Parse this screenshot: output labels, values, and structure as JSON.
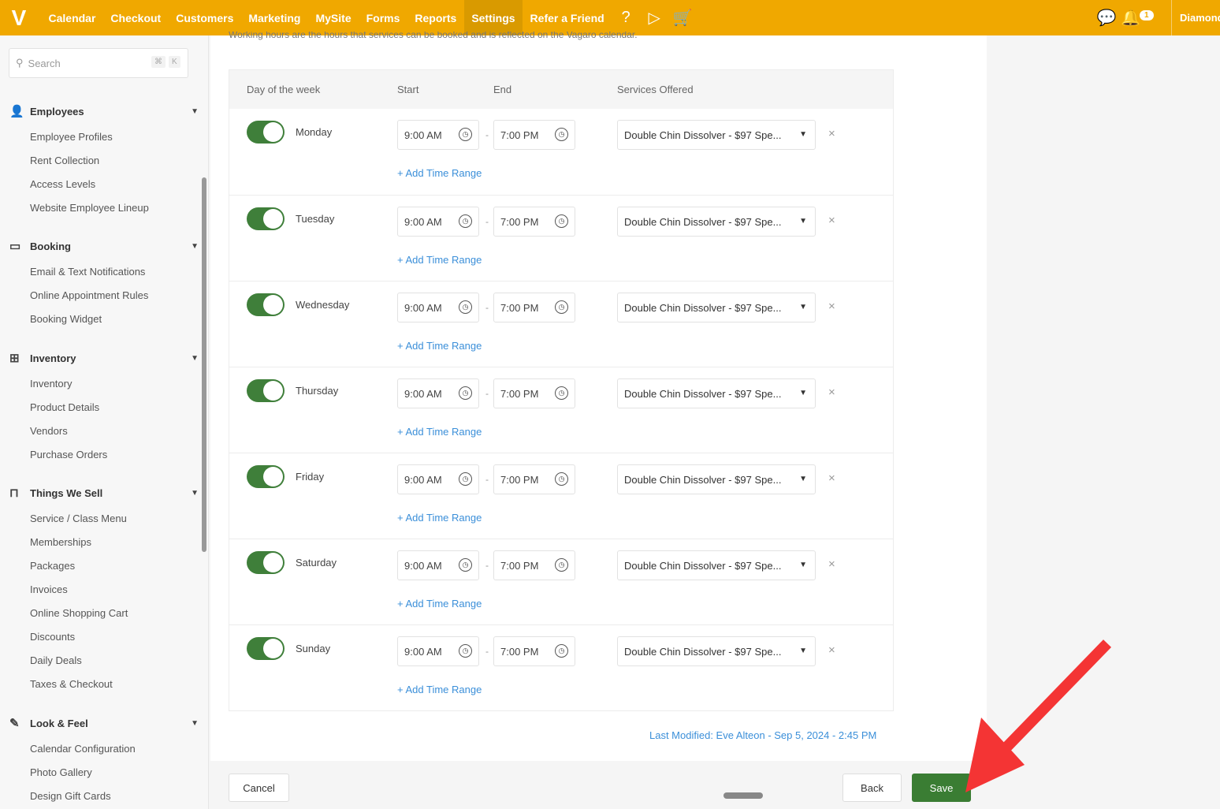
{
  "topbar": {
    "logo": "V",
    "nav": [
      "Calendar",
      "Checkout",
      "Customers",
      "Marketing",
      "MySite",
      "Forms",
      "Reports",
      "Settings",
      "Refer a Friend"
    ],
    "active": "Settings",
    "notification_count": "1",
    "account": "Diamond",
    "accent": "#f0a800"
  },
  "sidebar": {
    "search_placeholder": "Search",
    "shortcut": [
      "⌘",
      "K"
    ],
    "sections": [
      {
        "title": "Employees",
        "icon": "person-icon",
        "items": [
          "Employee Profiles",
          "Rent Collection",
          "Access Levels",
          "Website Employee Lineup"
        ]
      },
      {
        "title": "Booking",
        "icon": "calendar-icon",
        "items": [
          "Email & Text Notifications",
          "Online Appointment Rules",
          "Booking Widget"
        ]
      },
      {
        "title": "Inventory",
        "icon": "boxes-icon",
        "items": [
          "Inventory",
          "Product Details",
          "Vendors",
          "Purchase Orders"
        ]
      },
      {
        "title": "Things We Sell",
        "icon": "shopping-bag-icon",
        "items": [
          "Service / Class Menu",
          "Memberships",
          "Packages",
          "Invoices",
          "Online Shopping Cart",
          "Discounts",
          "Daily Deals",
          "Taxes & Checkout"
        ]
      },
      {
        "title": "Look & Feel",
        "icon": "pen-icon",
        "items": [
          "Calendar Configuration",
          "Photo Gallery",
          "Design Gift Cards"
        ]
      }
    ]
  },
  "main": {
    "intro": "Working hours are the hours that services can be booked and is reflected on the Vagaro calendar.",
    "headers": {
      "day": "Day of the week",
      "start": "Start",
      "end": "End",
      "services": "Services Offered"
    },
    "rows": [
      {
        "day": "Monday",
        "enabled": true,
        "start": "9:00 AM",
        "end": "7:00 PM",
        "service": "Double Chin Dissolver - $97 Spe..."
      },
      {
        "day": "Tuesday",
        "enabled": true,
        "start": "9:00 AM",
        "end": "7:00 PM",
        "service": "Double Chin Dissolver - $97 Spe..."
      },
      {
        "day": "Wednesday",
        "enabled": true,
        "start": "9:00 AM",
        "end": "7:00 PM",
        "service": "Double Chin Dissolver - $97 Spe..."
      },
      {
        "day": "Thursday",
        "enabled": true,
        "start": "9:00 AM",
        "end": "7:00 PM",
        "service": "Double Chin Dissolver - $97 Spe..."
      },
      {
        "day": "Friday",
        "enabled": true,
        "start": "9:00 AM",
        "end": "7:00 PM",
        "service": "Double Chin Dissolver - $97 Spe..."
      },
      {
        "day": "Saturday",
        "enabled": true,
        "start": "9:00 AM",
        "end": "7:00 PM",
        "service": "Double Chin Dissolver - $97 Spe..."
      },
      {
        "day": "Sunday",
        "enabled": true,
        "start": "9:00 AM",
        "end": "7:00 PM",
        "service": "Double Chin Dissolver - $97 Spe..."
      }
    ],
    "add_time_range": "+ Add Time Range",
    "last_modified": "Last Modified: Eve Alteon - Sep 5, 2024 - 2:45 PM"
  },
  "footer": {
    "cancel": "Cancel",
    "back": "Back",
    "save": "Save"
  }
}
